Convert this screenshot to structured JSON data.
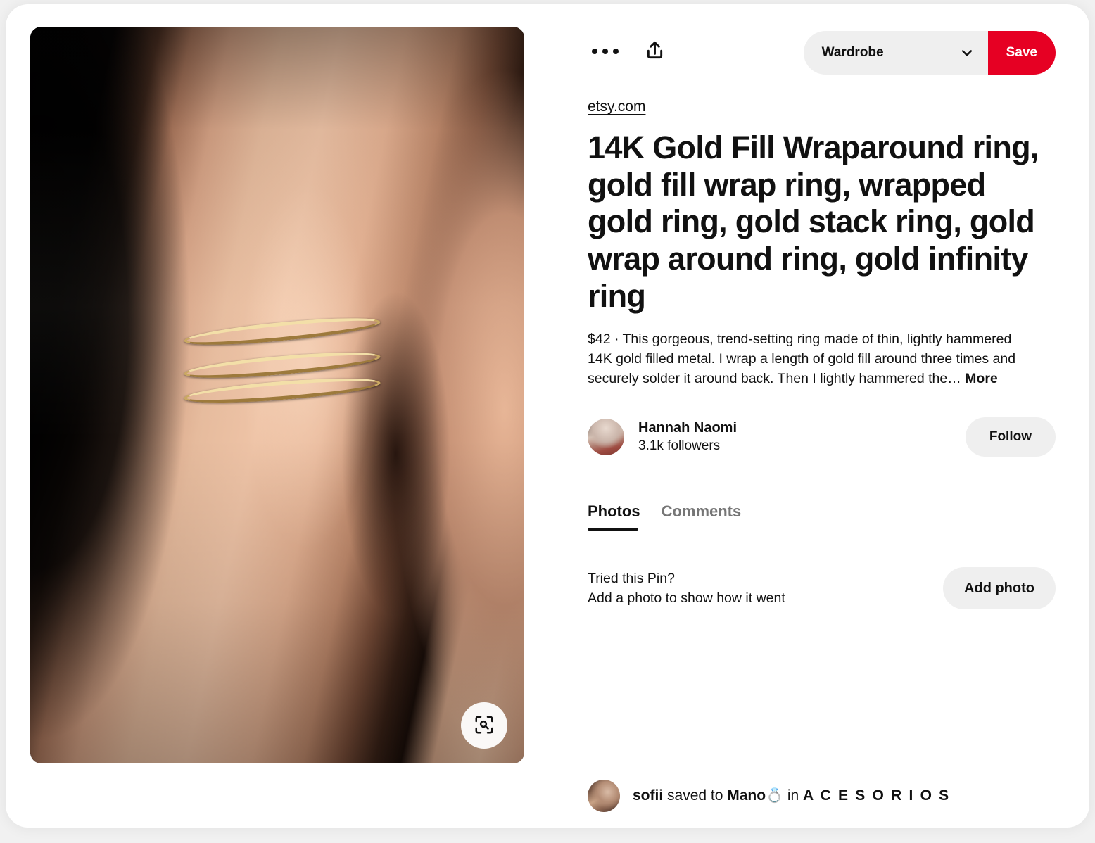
{
  "card": {
    "source_link": "etsy.com",
    "title": "14K Gold Fill Wraparound ring, gold fill wrap ring, wrapped gold ring, gold stack ring, gold wrap around ring, gold infinity ring",
    "description": "$42 · This gorgeous, trend-setting ring made of thin, lightly hammered 14K gold filled metal. I wrap a length of gold fill around three times and securely solder it around back. Then I lightly hammered the…",
    "description_more": "More"
  },
  "action_bar": {
    "more_options_icon": "ellipsis-icon",
    "share_icon": "share-icon",
    "board_name": "Wardrobe",
    "board_chevron_icon": "chevron-down-icon",
    "save_label": "Save"
  },
  "creator": {
    "avatar_icon": "creator-avatar",
    "name": "Hannah Naomi",
    "followers": "3.1k followers",
    "follow_label": "Follow"
  },
  "tabs": [
    {
      "label": "Photos",
      "active": true
    },
    {
      "label": "Comments",
      "active": false
    }
  ],
  "tried_this": {
    "title": "Tried this Pin?",
    "subtitle": "Add a photo to show how it went",
    "add_photo_label": "Add photo"
  },
  "saver": {
    "avatar_icon": "saver-avatar",
    "name": "sofii",
    "action": "saved to",
    "board_name_primary": "Mano",
    "board_emoji": "💍",
    "connector": "in",
    "board_name_secondary": "A C E S O R I O S"
  },
  "image": {
    "alt": "gold wraparound ring worn on a hand against a black background",
    "visual_search_icon": "visual-search-icon"
  },
  "colors": {
    "accent_red": "#e60023",
    "button_gray": "#efefef",
    "text_primary": "#111111",
    "text_secondary": "#767676",
    "page_background": "#f1f1f1",
    "card_background": "#ffffff"
  }
}
